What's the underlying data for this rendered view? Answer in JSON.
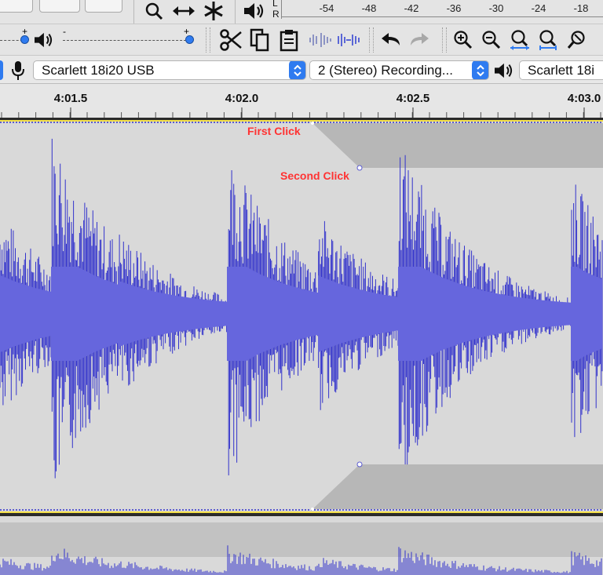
{
  "meter": {
    "left_channel": "L",
    "right_channel": "R",
    "ticks": [
      "-54",
      "-48",
      "-42",
      "-36",
      "-30",
      "-24",
      "-18"
    ]
  },
  "slider": {
    "minus": "-",
    "plus": "+"
  },
  "device_toolbar": {
    "recording_device": "Scarlett 18i20 USB",
    "channels": "2 (Stereo) Recording...",
    "playback_device": "Scarlett 18i"
  },
  "ruler": {
    "labels": [
      "4:01.5",
      "4:02.0",
      "4:02.5",
      "4:03.0"
    ]
  },
  "annotations": {
    "first_click": "First Click",
    "second_click": "Second Click"
  },
  "colors": {
    "waveform": "#3333cc",
    "waveform_rms": "#6666dd",
    "annotation": "#ff3333",
    "accent": "#2f7bf0"
  }
}
